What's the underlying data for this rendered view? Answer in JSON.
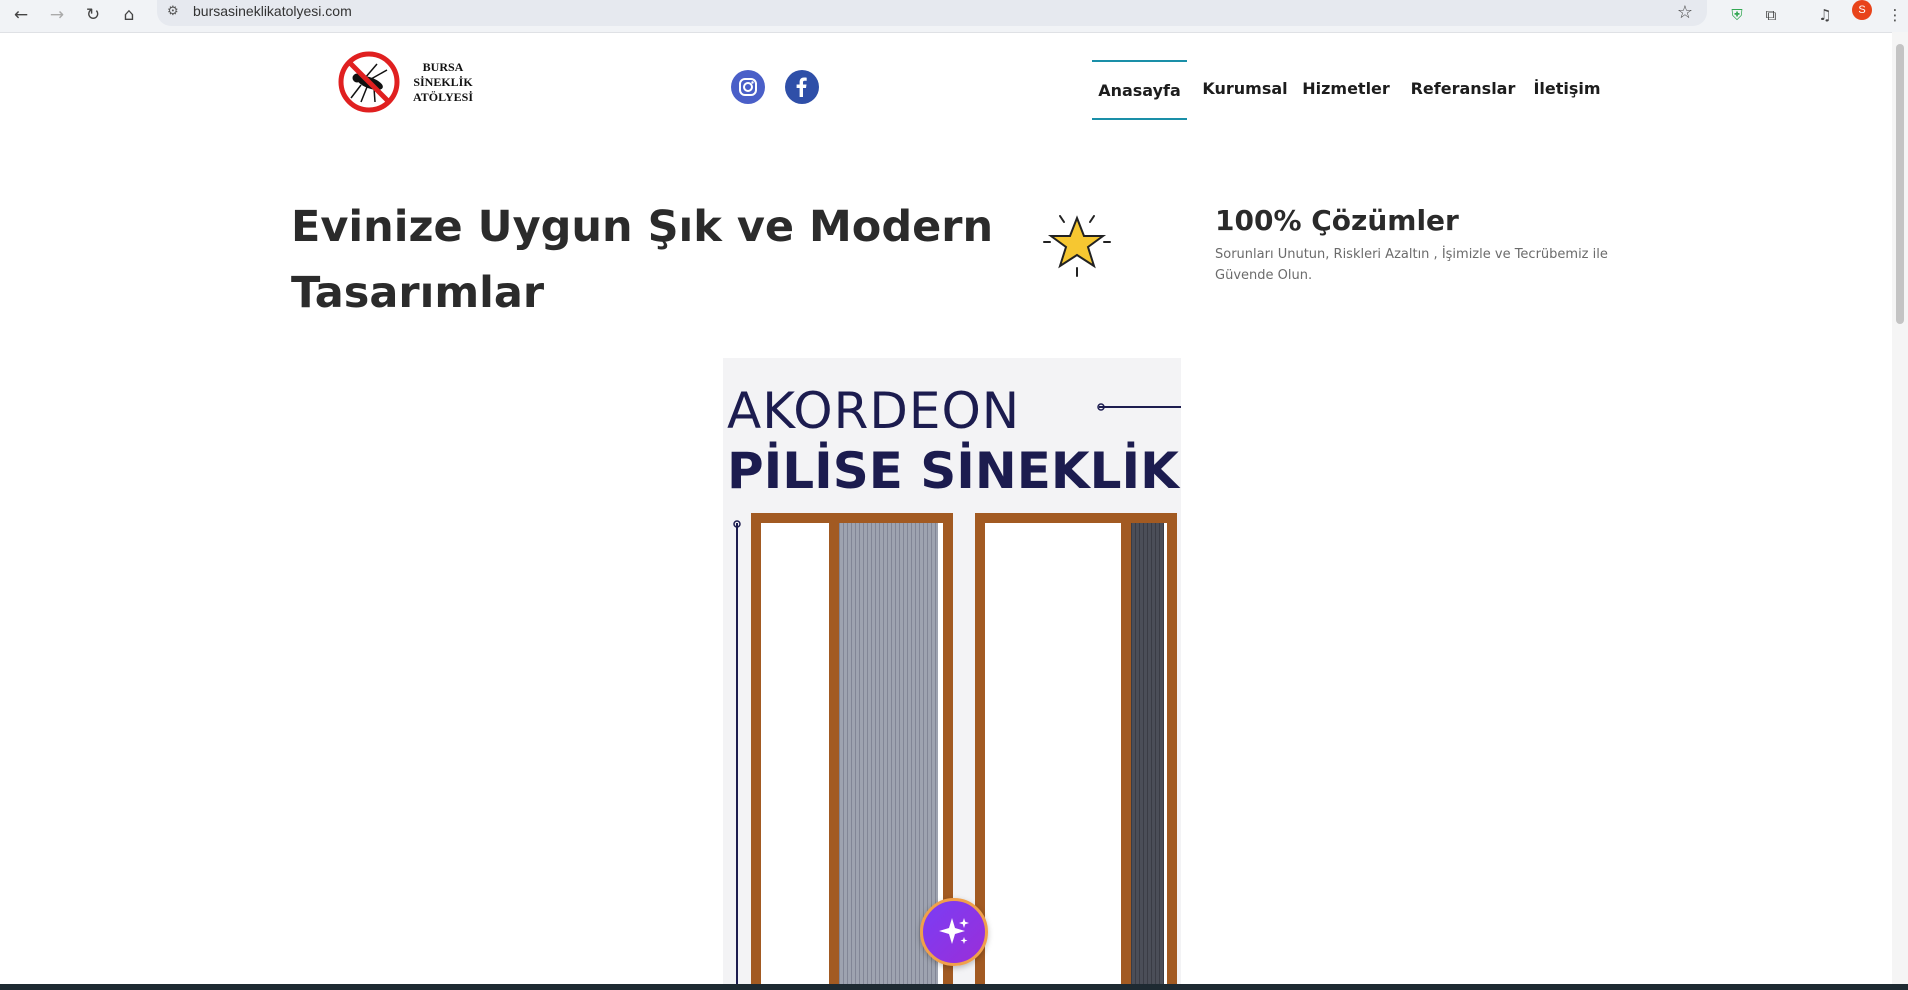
{
  "browser": {
    "url": "bursasineklikatolyesi.com",
    "profile_initial": "S"
  },
  "logo": {
    "line1": "BURSA",
    "line2": "SİNEKLİK",
    "line3": "ATÖLYESİ"
  },
  "social": [
    "instagram-icon",
    "facebook-icon"
  ],
  "nav": {
    "items": [
      "Anasayfa",
      "Kurumsal",
      "Hizmetler",
      "Referanslar",
      "İletişim"
    ],
    "active": "Anasayfa",
    "accent": "#1a8fa8"
  },
  "hero": {
    "title_line1": "Evinize Uygun Şık ve Modern",
    "title_line2": "Tasarımlar"
  },
  "feature": {
    "icon": "star-icon",
    "title": "100% Çözümler",
    "description": "Sorunları Unutun, Riskleri Azaltın , İşimizle ve Tecrübemiz ile Güvende Olun."
  },
  "product_image": {
    "line1": "AKORDEON",
    "line2": "PİLİSE SİNEKLİK"
  },
  "fab": {
    "icon": "sparkle-icon",
    "color": "#7a3df5"
  }
}
